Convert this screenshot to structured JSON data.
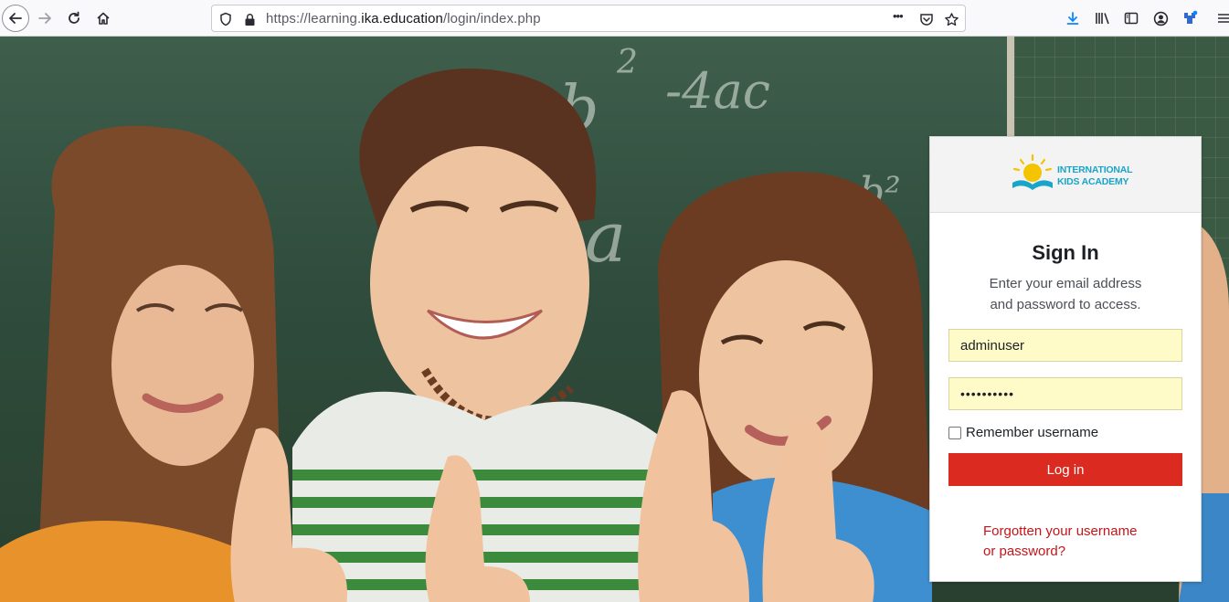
{
  "browser": {
    "url_prefix": "https://learning.",
    "url_domain": "ika.education",
    "url_path": "/login/index.php",
    "page_actions_glyph": "•••"
  },
  "login": {
    "logo_line1": "INTERNATIONAL",
    "logo_line2": "KIDS ACADEMY",
    "title": "Sign In",
    "subtitle_line1": "Enter your email address",
    "subtitle_line2": "and password to access.",
    "username_value": "adminuser",
    "password_value": "••••••••••",
    "remember_label": "Remember username",
    "remember_checked": false,
    "login_button": "Log in",
    "forgot_line1": "Forgotten your username",
    "forgot_line2": "or password?"
  },
  "colors": {
    "login_button": "#db2a1f",
    "forgot_link": "#c4151a",
    "autofill_field": "#fefbc8",
    "logo_text": "#1aa5c8",
    "logo_sun": "#f5c400",
    "download_icon": "#0a84ff"
  },
  "background": {
    "chalk_1": "b",
    "chalk_2": "-4ac",
    "chalk_3": "2",
    "chalk_4": "a",
    "chalk_5": "b²"
  }
}
